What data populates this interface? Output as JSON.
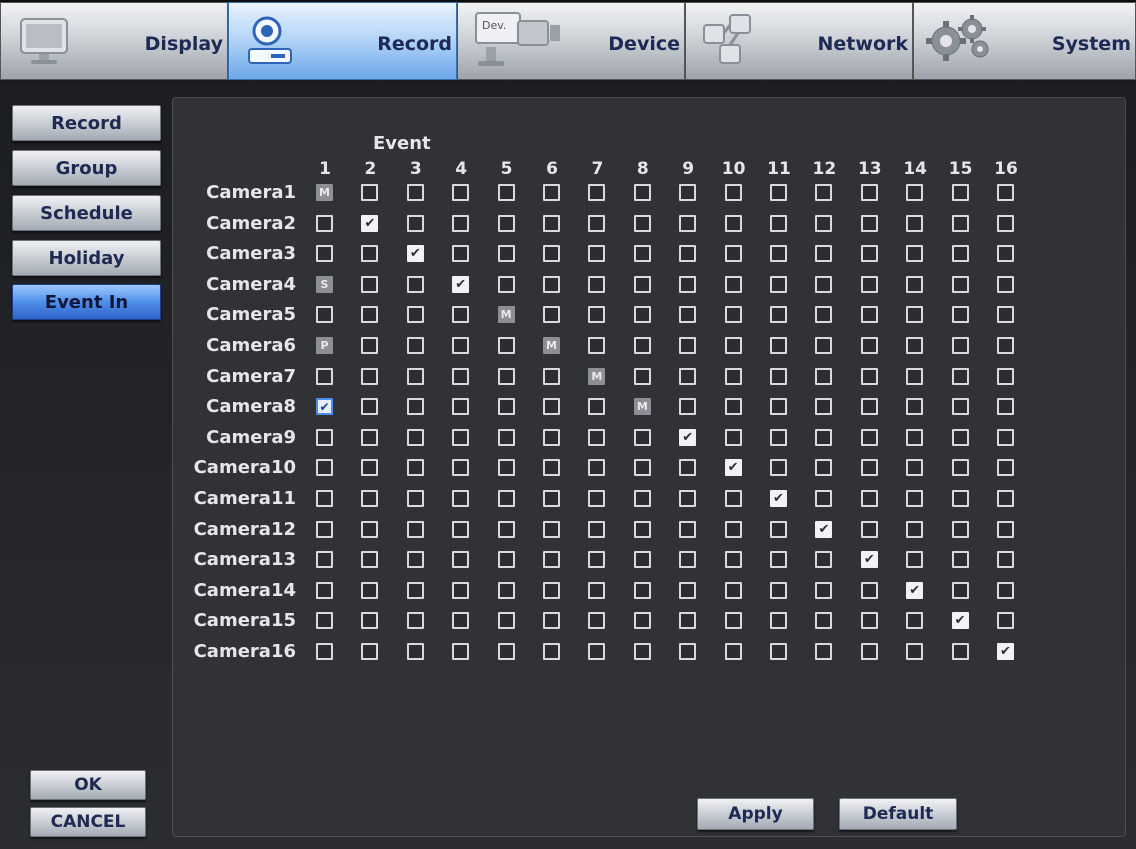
{
  "tabs": [
    {
      "label": "Display",
      "icon": "monitor-icon",
      "active": false
    },
    {
      "label": "Record",
      "icon": "camera-icon",
      "active": true
    },
    {
      "label": "Device",
      "icon": "device-camera-icon",
      "active": false
    },
    {
      "label": "Network",
      "icon": "network-icon",
      "active": false
    },
    {
      "label": "System",
      "icon": "gear-icon",
      "active": false
    }
  ],
  "device_icon_text": "Dev.",
  "sidebar": {
    "items": [
      {
        "label": "Record",
        "active": false
      },
      {
        "label": "Group",
        "active": false
      },
      {
        "label": "Schedule",
        "active": false
      },
      {
        "label": "Holiday",
        "active": false
      },
      {
        "label": "Event In",
        "active": true
      }
    ]
  },
  "footer": {
    "ok_label": "OK",
    "cancel_label": "CANCEL"
  },
  "grid": {
    "title": "Event",
    "columns": [
      "1",
      "2",
      "3",
      "4",
      "5",
      "6",
      "7",
      "8",
      "9",
      "10",
      "11",
      "12",
      "13",
      "14",
      "15",
      "16"
    ],
    "rows": [
      {
        "camera": "Camera1",
        "cells": {
          "1": "M"
        }
      },
      {
        "camera": "Camera2",
        "cells": {
          "2": "check"
        }
      },
      {
        "camera": "Camera3",
        "cells": {
          "3": "check"
        }
      },
      {
        "camera": "Camera4",
        "cells": {
          "1": "S",
          "4": "check"
        }
      },
      {
        "camera": "Camera5",
        "cells": {
          "5": "M"
        }
      },
      {
        "camera": "Camera6",
        "cells": {
          "1": "P",
          "6": "M"
        }
      },
      {
        "camera": "Camera7",
        "cells": {
          "7": "M"
        }
      },
      {
        "camera": "Camera8",
        "cells": {
          "1": "check-highlight",
          "8": "M"
        }
      },
      {
        "camera": "Camera9",
        "cells": {
          "9": "check"
        }
      },
      {
        "camera": "Camera10",
        "cells": {
          "10": "check"
        }
      },
      {
        "camera": "Camera11",
        "cells": {
          "11": "check"
        }
      },
      {
        "camera": "Camera12",
        "cells": {
          "12": "check"
        }
      },
      {
        "camera": "Camera13",
        "cells": {
          "13": "check"
        }
      },
      {
        "camera": "Camera14",
        "cells": {
          "14": "check"
        }
      },
      {
        "camera": "Camera15",
        "cells": {
          "15": "check"
        }
      },
      {
        "camera": "Camera16",
        "cells": {
          "16": "check"
        }
      }
    ]
  },
  "actions": {
    "apply_label": "Apply",
    "default_label": "Default"
  },
  "colors": {
    "accent": "#4d8ff0",
    "panel": "#303235",
    "text": "#e4e6ea"
  }
}
